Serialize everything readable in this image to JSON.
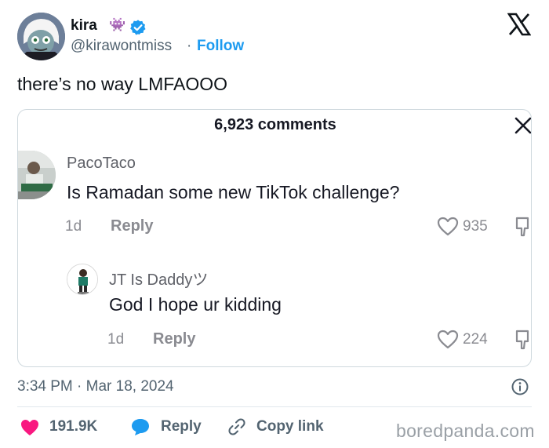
{
  "tweet": {
    "author_name": "kira",
    "author_emoji": "👾",
    "handle": "@kirawontmiss",
    "separator": "·",
    "follow_label": "Follow",
    "text": "there’s no way LMFAOOO",
    "timestamp": "3:34 PM · Mar 18, 2024"
  },
  "embedded": {
    "comments_count": "6,923 comments",
    "comments": [
      {
        "username": "PacoTaco",
        "text": "Is Ramadan some new TikTok challenge?",
        "age": "1d",
        "reply_label": "Reply",
        "likes": "935"
      },
      {
        "username": "JT Is Daddyツ",
        "text": "God I hope ur kidding",
        "age": "1d",
        "reply_label": "Reply",
        "likes": "224"
      }
    ]
  },
  "actions": {
    "likes": "191.9K",
    "reply_label": "Reply",
    "copy_link_label": "Copy link"
  },
  "watermark": "boredpanda.com",
  "colors": {
    "accent_blue": "#1d9bf0",
    "like_pink": "#f91880",
    "text_primary": "#0f1419",
    "text_secondary": "#536471"
  },
  "icons": [
    "verified-badge-icon",
    "x-logo-icon",
    "close-icon",
    "heart-outline-icon",
    "dislike-icon",
    "info-icon",
    "heart-filled-icon",
    "reply-bubble-icon",
    "link-icon"
  ]
}
